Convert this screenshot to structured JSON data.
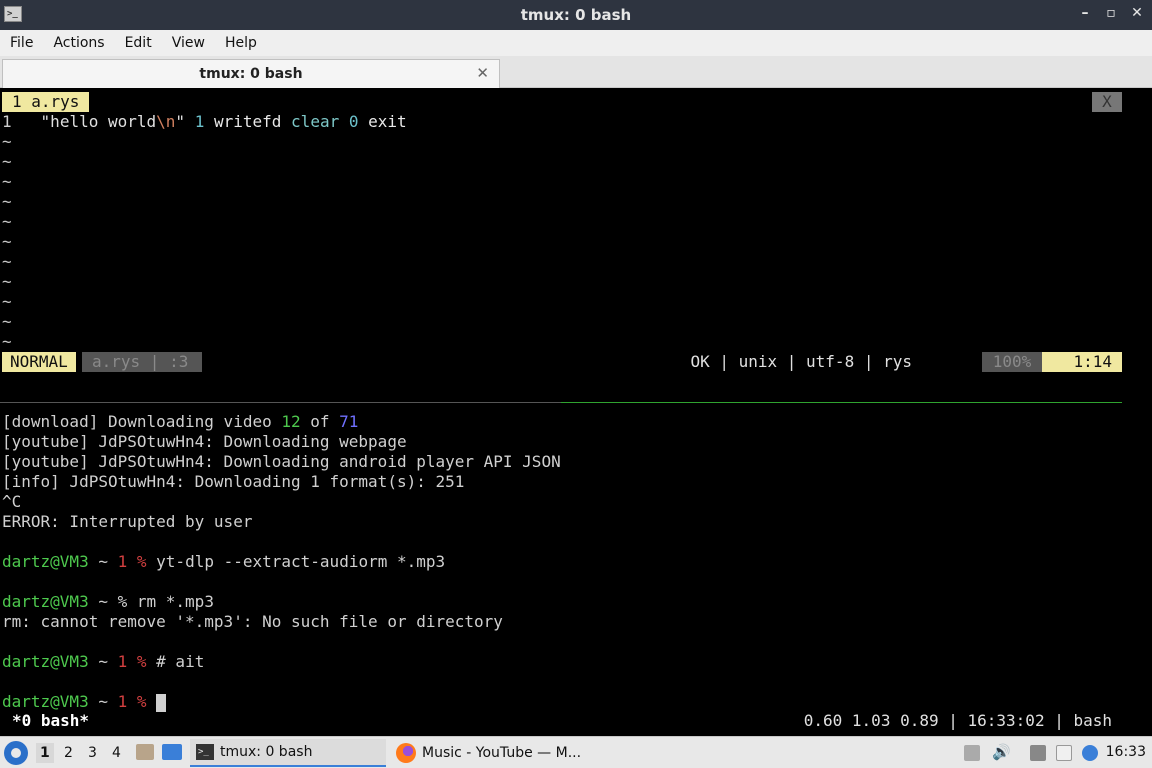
{
  "window": {
    "title": "tmux: 0 bash",
    "app_icon_text": ">_",
    "buttons": {
      "minimize": "–",
      "maximize": "▫",
      "close": "✕"
    }
  },
  "menu": [
    "File",
    "Actions",
    "Edit",
    "View",
    "Help"
  ],
  "tab": {
    "label": "tmux: 0 bash",
    "close": "✕"
  },
  "vim": {
    "tab_label": "1 a.rys",
    "close_label": "X",
    "code_line": {
      "number": "1",
      "parts": [
        "\"hello world",
        "\\n",
        "\"",
        "1",
        "writefd",
        "clear",
        "0",
        "exit"
      ]
    },
    "tilde": "~",
    "status": {
      "mode": "NORMAL",
      "file": "a.rys | :3",
      "info": "OK | unix | utf-8 | rys",
      "percent": "100%",
      "position": "1:14"
    }
  },
  "shell": {
    "lines": [
      "[download] Downloading video ",
      "[youtube] JdPSOtuwHn4: Downloading webpage",
      "[youtube] JdPSOtuwHn4: Downloading android player API JSON",
      "[info] JdPSOtuwHn4: Downloading 1 format(s): 251",
      "^C",
      "ERROR: Interrupted by user",
      "rm: cannot remove '*.mp3': No such file or directory"
    ],
    "download_current": "12",
    "download_of": " of ",
    "download_total": "71",
    "prompt_user": "dartz@VM3",
    "prompt_tilde": " ~ ",
    "exit_code": "1",
    "percent": "%",
    "cmd1": " yt-dlp --extract-audiorm *.mp3",
    "cmd2": " rm *.mp3",
    "cmd3": " # ait"
  },
  "tmux_status": {
    "left": "*0 bash*",
    "right": "0.60 1.03 0.89 | 16:33:02 | bash"
  },
  "taskbar": {
    "workspaces": [
      "1",
      "2",
      "3",
      "4"
    ],
    "tasks": [
      {
        "label": "tmux: 0 bash",
        "icon": "terminal-icon"
      },
      {
        "label": "Music - YouTube — M...",
        "icon": "firefox-icon"
      }
    ],
    "clock": "16:33"
  }
}
